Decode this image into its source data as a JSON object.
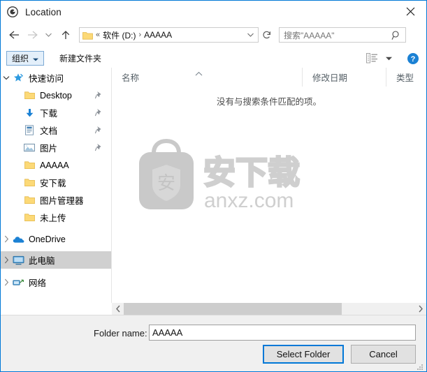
{
  "window": {
    "title": "Location",
    "title_icon": "location-target-icon",
    "close_label": "✕",
    "accent_color": "#0078d7"
  },
  "nav": {
    "back_label": "←",
    "forward_label": "→",
    "recent_label": "ˇ",
    "up_label": "↑",
    "refresh_label": "↻"
  },
  "address": {
    "overflow": "«",
    "crumbs": [
      {
        "label": "软件 (D:)"
      },
      {
        "label": "AAAAA"
      }
    ],
    "separator": "›",
    "chevron": "ˇ"
  },
  "search": {
    "placeholder": "搜索\"AAAAA\"",
    "icon": "search-icon"
  },
  "toolbar": {
    "organize_label": "组织",
    "organize_caret": "▼",
    "new_folder_label": "新建文件夹",
    "view_icon": "view-layout-icon",
    "view_caret": "▼",
    "help_label": "?"
  },
  "sidebar": {
    "items": [
      {
        "label": "快速访问",
        "icon": "star-pin-icon",
        "expander": "ˇ",
        "level": 0,
        "pinned": false,
        "selected": false
      },
      {
        "label": "Desktop",
        "icon": "folder-icon",
        "expander": "",
        "level": 1,
        "pinned": true,
        "selected": false
      },
      {
        "label": "下载",
        "icon": "download-arrow-icon",
        "expander": "",
        "level": 1,
        "pinned": true,
        "selected": false
      },
      {
        "label": "文档",
        "icon": "document-icon",
        "expander": "",
        "level": 1,
        "pinned": true,
        "selected": false
      },
      {
        "label": "图片",
        "icon": "pictures-icon",
        "expander": "",
        "level": 1,
        "pinned": true,
        "selected": false
      },
      {
        "label": "AAAAA",
        "icon": "folder-icon",
        "expander": "",
        "level": 1,
        "pinned": false,
        "selected": false
      },
      {
        "label": "安下载",
        "icon": "folder-icon",
        "expander": "",
        "level": 1,
        "pinned": false,
        "selected": false
      },
      {
        "label": "图片管理器",
        "icon": "folder-icon",
        "expander": "",
        "level": 1,
        "pinned": false,
        "selected": false
      },
      {
        "label": "未上传",
        "icon": "folder-icon",
        "expander": "",
        "level": 1,
        "pinned": false,
        "selected": false
      },
      {
        "label": "OneDrive",
        "icon": "onedrive-cloud-icon",
        "expander": "›",
        "level": 0,
        "pinned": false,
        "selected": false
      },
      {
        "label": "此电脑",
        "icon": "this-pc-monitor-icon",
        "expander": "›",
        "level": 0,
        "pinned": false,
        "selected": true
      },
      {
        "label": "网络",
        "icon": "network-icon",
        "expander": "›",
        "level": 0,
        "pinned": false,
        "selected": false
      }
    ]
  },
  "filelist": {
    "columns": [
      {
        "label": "名称",
        "sorted": true,
        "sort_arrow": "∧"
      },
      {
        "label": "修改日期",
        "sorted": false,
        "sort_arrow": ""
      },
      {
        "label": "类型",
        "sorted": false,
        "sort_arrow": ""
      }
    ],
    "rows": [],
    "empty_message": "没有与搜索条件匹配的项。"
  },
  "watermark": {
    "badge_char": "安",
    "brand_cn": "安下载",
    "brand_domain": "anxz.com",
    "color": "#c9c9c9"
  },
  "hscroll": {
    "left_arrow": "‹",
    "right_arrow": "›"
  },
  "bottom": {
    "folder_name_label": "Folder name:",
    "folder_name_value": "AAAAA",
    "folder_name_placeholder": "",
    "select_label": "Select Folder",
    "cancel_label": "Cancel"
  }
}
